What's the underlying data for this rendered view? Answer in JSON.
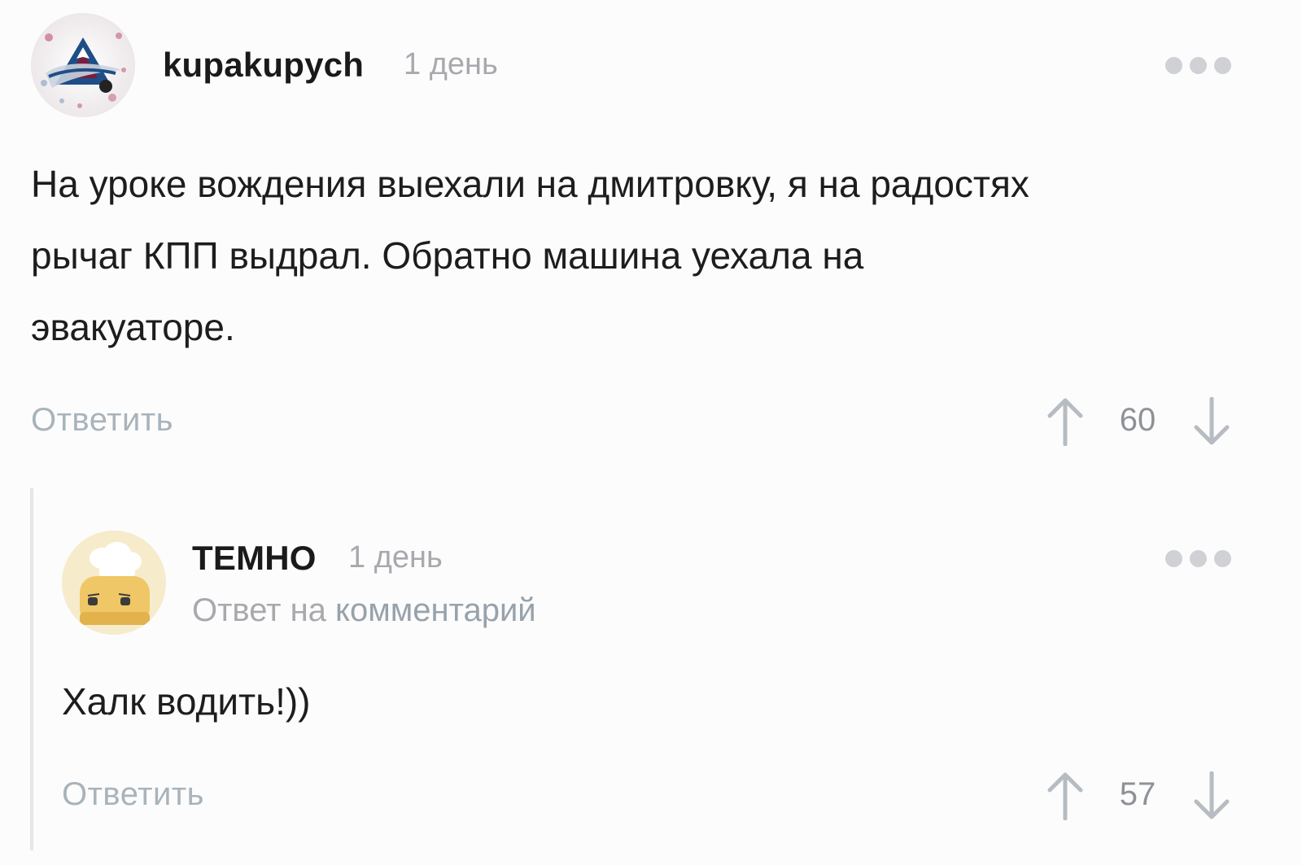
{
  "comments": [
    {
      "username": "kupakupych",
      "time": "1 день",
      "avatar_icon": "colorado-avalanche-logo-icon",
      "text_lines": [
        "На уроке вождения выехали на дмитровку, я на радостях",
        "рычаг КПП выдрал. Обратно машина уехала на",
        "эвакуаторе."
      ],
      "reply_label": "Ответить",
      "votes": "60"
    },
    {
      "username": "ТЕМНО",
      "time": "1 день",
      "avatar_icon": "toaster-chef-icon",
      "reply_prefix": "Ответ на",
      "reply_link": "комментарий",
      "text_lines": [
        "Халк водить!))"
      ],
      "reply_label": "Ответить",
      "votes": "57"
    }
  ],
  "colors": {
    "username": "#1a1a1a",
    "muted": "#a7a9ad",
    "link": "#97a2ab",
    "dots": "#cfd1d4",
    "thread_line": "#e4e6e8"
  },
  "icons": {
    "more": "more-dots-icon",
    "upvote": "arrow-up-icon",
    "downvote": "arrow-down-icon"
  }
}
